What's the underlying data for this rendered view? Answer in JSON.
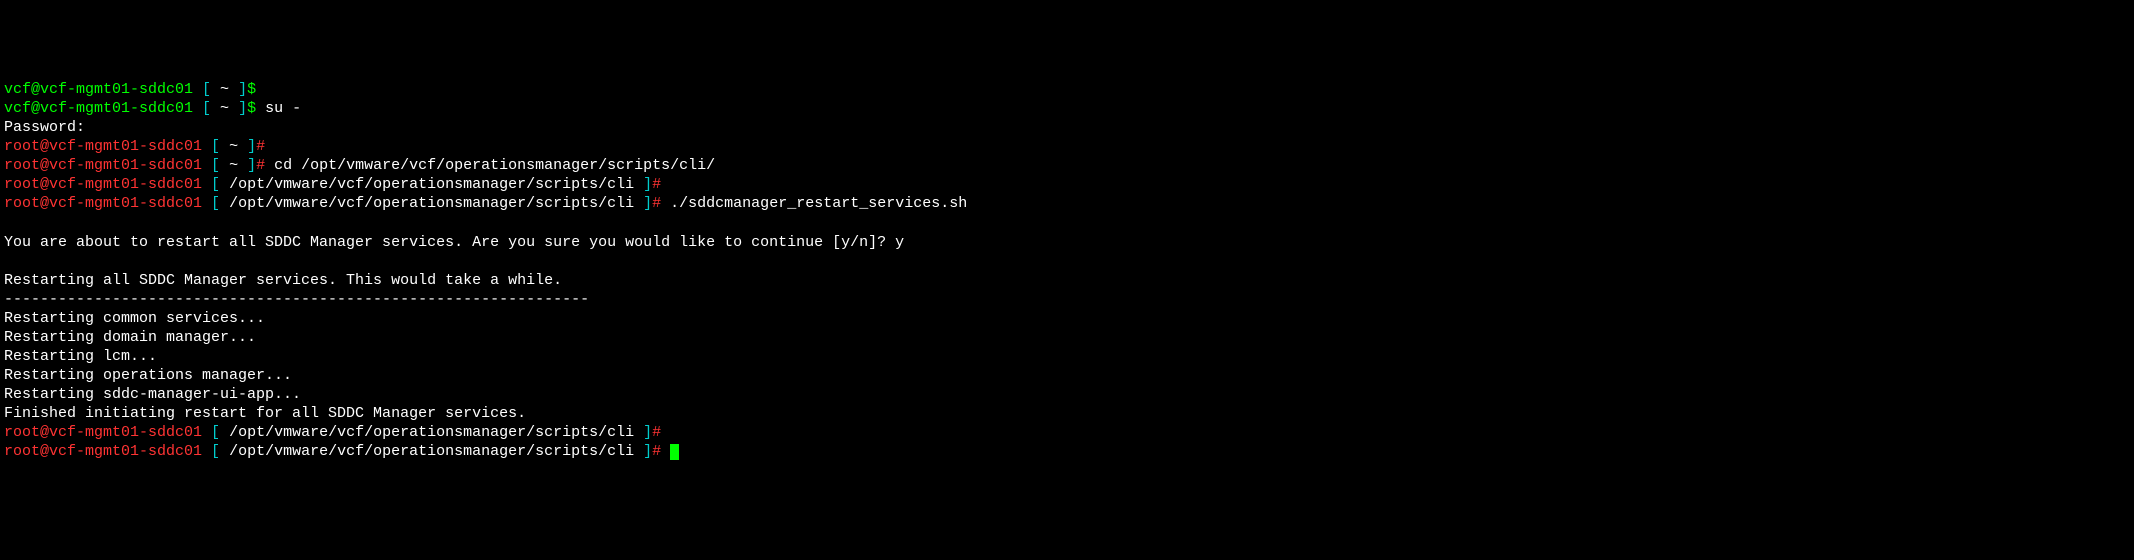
{
  "lines": {
    "l1_user": "vcf@vcf-mgmt01-sddc01",
    "l1_bracket_open": " [ ",
    "l1_path": "~",
    "l1_bracket_close": " ]",
    "l1_prompt": "$",
    "l2_user": "vcf@vcf-mgmt01-sddc01",
    "l2_bracket_open": " [ ",
    "l2_path": "~",
    "l2_bracket_close": " ]",
    "l2_prompt": "$ ",
    "l2_cmd": "su -",
    "l3": "Password:",
    "l4_user": "root@vcf-mgmt01-sddc01",
    "l4_bracket_open": " [ ",
    "l4_path": "~",
    "l4_bracket_close": " ]",
    "l4_prompt": "#",
    "l5_user": "root@vcf-mgmt01-sddc01",
    "l5_bracket_open": " [ ",
    "l5_path": "~",
    "l5_bracket_close": " ]",
    "l5_prompt": "# ",
    "l5_cmd": "cd /opt/vmware/vcf/operationsmanager/scripts/cli/",
    "l6_user": "root@vcf-mgmt01-sddc01",
    "l6_bracket_open": " [ ",
    "l6_path": "/opt/vmware/vcf/operationsmanager/scripts/cli",
    "l6_bracket_close": " ]",
    "l6_prompt": "#",
    "l7_user": "root@vcf-mgmt01-sddc01",
    "l7_bracket_open": " [ ",
    "l7_path": "/opt/vmware/vcf/operationsmanager/scripts/cli",
    "l7_bracket_close": " ]",
    "l7_prompt": "# ",
    "l7_cmd": "./sddcmanager_restart_services.sh",
    "l8": "",
    "l9": "You are about to restart all SDDC Manager services. Are you sure you would like to continue [y/n]? y",
    "l10": "",
    "l11": "Restarting all SDDC Manager services. This would take a while.",
    "l12": "-----------------------------------------------------------------",
    "l13": "Restarting common services...",
    "l14": "Restarting domain manager...",
    "l15": "Restarting lcm...",
    "l16": "Restarting operations manager...",
    "l17": "Restarting sddc-manager-ui-app...",
    "l18": "Finished initiating restart for all SDDC Manager services.",
    "l19_user": "root@vcf-mgmt01-sddc01",
    "l19_bracket_open": " [ ",
    "l19_path": "/opt/vmware/vcf/operationsmanager/scripts/cli",
    "l19_bracket_close": " ]",
    "l19_prompt": "#",
    "l20_user": "root@vcf-mgmt01-sddc01",
    "l20_bracket_open": " [ ",
    "l20_path": "/opt/vmware/vcf/operationsmanager/scripts/cli",
    "l20_bracket_close": " ]",
    "l20_prompt": "# "
  }
}
